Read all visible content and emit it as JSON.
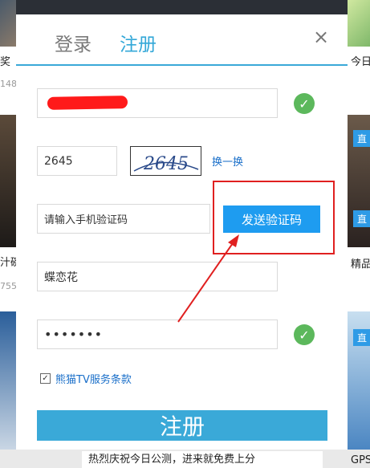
{
  "background": {
    "left_text_1": "奖",
    "left_num_1": "148",
    "left_text_2": "汁碗",
    "left_num_2": "755",
    "right_text_1": "今日",
    "right_tag_1": "直",
    "right_text_2": "精品",
    "right_tag_2": "直",
    "right_tag_3": "直",
    "right_text_3": "GPS",
    "bottom_text": "热烈庆祝今日公测，进来就免费上分"
  },
  "tabs": {
    "login": "登录",
    "register": "注册"
  },
  "close_icon": "×",
  "form": {
    "phone_value": "",
    "captcha_value": "2645",
    "captcha_image_text": "2645",
    "swap_link": "换一换",
    "sms_code_placeholder": "请输入手机验证码",
    "send_code_button": "发送验证码",
    "nickname_value": "蝶恋花",
    "password_value": "•••••••",
    "agree_checkbox_mark": "✓",
    "agree_label": "熊猫TV服务条款",
    "submit_button": "注册"
  },
  "colors": {
    "accent": "#3aa9d8",
    "send_button": "#1e9cf0",
    "success": "#5cb85c",
    "annotation_red": "#e02020"
  },
  "icons": {
    "valid": "check-circle-icon"
  }
}
